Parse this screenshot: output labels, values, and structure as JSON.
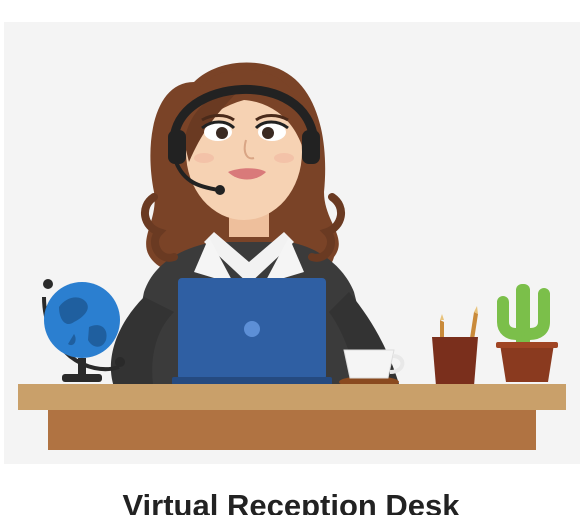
{
  "card": {
    "title": "Virtual Reception Desk"
  },
  "illustration": {
    "subject": "receptionist-with-headset",
    "objects": [
      "globe-icon",
      "laptop-icon",
      "coffee-cup-icon",
      "pencil-cup-icon",
      "cactus-icon",
      "desk"
    ]
  },
  "colors": {
    "background": "#f4f4f4",
    "hair": "#7a4327",
    "skin": "#f6d2b3",
    "jacket": "#3b3b3b",
    "laptop": "#2f5fa3",
    "desk_top": "#c9a06a",
    "desk_front": "#b07342",
    "cactus": "#7bbf4a",
    "pot": "#8a3a1f"
  }
}
